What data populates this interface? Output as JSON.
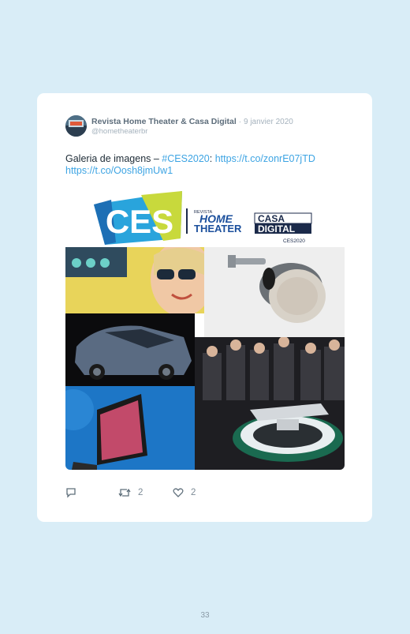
{
  "tweet": {
    "author_name": "Revista Home Theater & Casa Digital",
    "separator": "·",
    "date": "9 janvier 2020",
    "handle": "@hometheaterbr",
    "text_prefix": "Galeria de imagens – ",
    "hashtag": "#CES2020",
    "colon": ":",
    "link1": "https://t.co/zonrE07jTD",
    "link2": "https://t.co/Oosh8jmUw1"
  },
  "media": {
    "ces_logo_text": "CES",
    "revista_label": "REVISTA",
    "home_label": "HOME",
    "theater_label": "THEATER",
    "casa_label": "CASA",
    "digital_label": "DIGITAL",
    "event_label": "CES2020"
  },
  "actions": {
    "reply_icon": "reply-icon",
    "retweet_icon": "retweet-icon",
    "retweet_count": "2",
    "like_icon": "heart-icon",
    "like_count": "2"
  },
  "page_number": "33",
  "colors": {
    "background": "#d9edf7",
    "link": "#3da4e3",
    "muted": "#a5b2bd"
  }
}
